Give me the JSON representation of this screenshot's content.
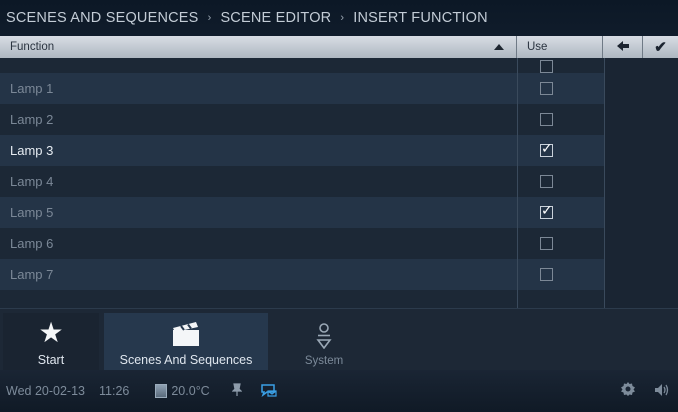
{
  "breadcrumb": {
    "items": [
      "SCENES AND SEQUENCES",
      "SCENE EDITOR",
      "INSERT FUNCTION"
    ],
    "separator": "›"
  },
  "table": {
    "col_function": "Function",
    "col_use": "Use",
    "back_icon": "←",
    "confirm_icon": "✔",
    "rows": [
      {
        "label": "Lamp 1",
        "checked": false,
        "enabled": false
      },
      {
        "label": "Lamp 2",
        "checked": false,
        "enabled": false
      },
      {
        "label": "Lamp 3",
        "checked": true,
        "enabled": true
      },
      {
        "label": "Lamp 4",
        "checked": false,
        "enabled": false
      },
      {
        "label": "Lamp 5",
        "checked": true,
        "enabled": false
      },
      {
        "label": "Lamp 6",
        "checked": false,
        "enabled": false
      },
      {
        "label": "Lamp 7",
        "checked": false,
        "enabled": false
      }
    ]
  },
  "tabs": {
    "start": {
      "label": "Start",
      "icon": "star-icon"
    },
    "scenes": {
      "label": "Scenes And Sequences",
      "icon": "clapperboard-icon"
    },
    "system": {
      "label": "System",
      "icon": "system-icon"
    }
  },
  "status": {
    "date": "Wed 20-02-13",
    "time": "11:26",
    "temperature": "20.0°C",
    "pin_icon": "pin-icon",
    "message_icon": "message-icon",
    "gear_icon": "gear-icon",
    "speaker_icon": "speaker-icon"
  },
  "colors": {
    "background": "#1b2634",
    "row_dark": "#1c2836",
    "row_light": "#243447",
    "header": "#c6ccd4",
    "active_tab": "#26384d"
  }
}
